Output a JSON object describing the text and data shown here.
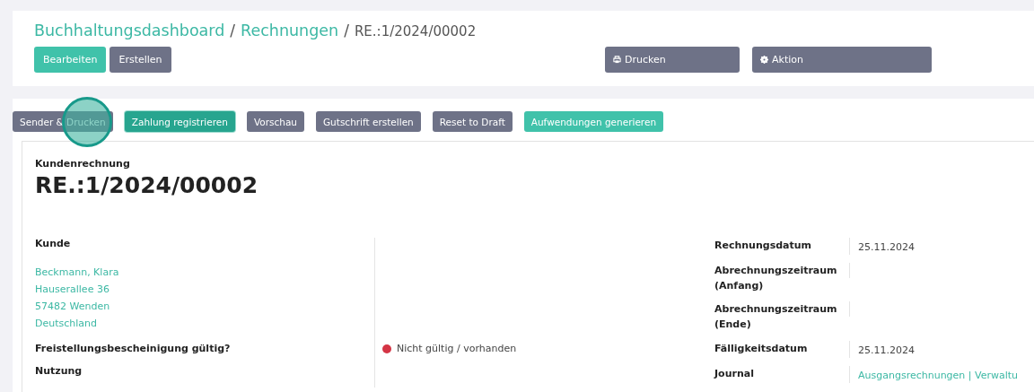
{
  "breadcrumb": [
    {
      "label": "Buchhaltungsdashboard",
      "kind": "link"
    },
    {
      "label": "Rechnungen",
      "kind": "link",
      "separator": "/"
    },
    {
      "label": "RE.:1/2024/00002",
      "kind": "current",
      "separator": "/"
    }
  ],
  "toolbar": {
    "buttons": [
      {
        "label": "Bearbeiten",
        "kind": "primary"
      },
      {
        "label": "Erstellen",
        "kind": "secondary"
      }
    ],
    "right_buttons": [
      {
        "label": "Drucken",
        "kind": "print"
      },
      {
        "label": "Aktion",
        "kind": "gear"
      }
    ]
  },
  "actions": [
    {
      "label": "Sender & Drucken",
      "kind": "secondary",
      "focused": false
    },
    {
      "label": "Zahlung registrieren",
      "kind": "primary",
      "focused": true
    },
    {
      "label": "Vorschau",
      "kind": "secondary",
      "focused": false
    },
    {
      "label": "Gutschrift erstellen",
      "kind": "secondary",
      "focused": false
    },
    {
      "label": "Reset to Draft",
      "kind": "secondary",
      "focused": false
    },
    {
      "label": "Aufwendungen generieren",
      "kind": "primary",
      "focused": false
    }
  ],
  "document": {
    "type_label": "Kundenrechnung",
    "number": "RE.:1/2024/00002",
    "left_fields": [
      {
        "label": "Kunde",
        "lines": [
          "Beckmann, Klara",
          "Hauserallee 36",
          "57482 Wenden",
          "Deutschland"
        ]
      },
      {
        "label": "Freistellungsbescheinigung gültig?",
        "status": {
          "text": "Nicht gültig / vorhanden",
          "color": "#d43545"
        }
      },
      {
        "label": "Nutzung"
      }
    ],
    "right_fields": [
      {
        "label": "Rechnungsdatum",
        "value": "25.11.2024",
        "kind": "text"
      },
      {
        "label": "Abrechnungszeitraum (Anfang)"
      },
      {
        "label": "Abrechnungszeitraum (Ende)"
      },
      {
        "label": "Fälligkeitsdatum",
        "value": "25.11.2024",
        "kind": "text"
      },
      {
        "label": "Journal",
        "value": "Ausgangsrechnungen | Verwaltu",
        "kind": "link"
      }
    ]
  }
}
